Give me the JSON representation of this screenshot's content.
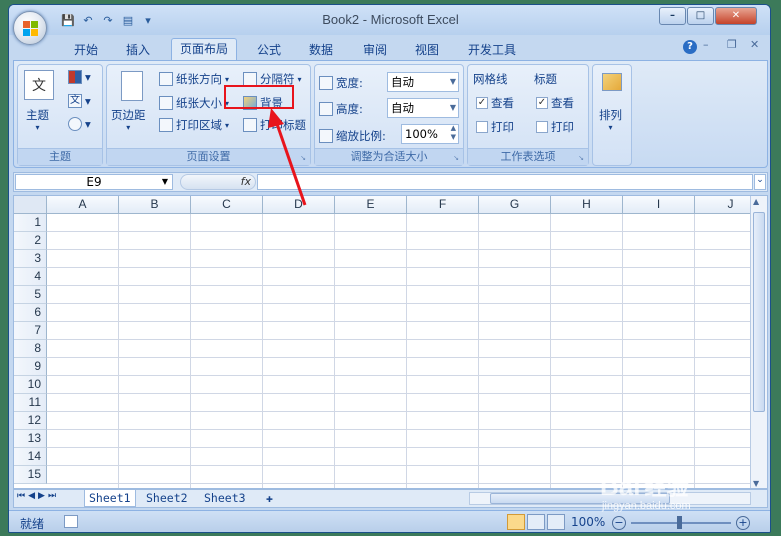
{
  "window": {
    "title": "Book2 - Microsoft Excel"
  },
  "qat": {
    "save_icon": "💾",
    "undo_icon": "↶",
    "redo_icon": "↷",
    "print_preview_icon": "▤",
    "customize_icon": "▾"
  },
  "tabs": [
    "开始",
    "插入",
    "页面布局",
    "公式",
    "数据",
    "审阅",
    "视图",
    "开发工具"
  ],
  "active_tab": "页面布局",
  "ribbon": {
    "theme": {
      "big_label": "主题",
      "group": "主题"
    },
    "page_setup": {
      "margins": "页边距",
      "orientation": "纸张方向",
      "size": "纸张大小",
      "print_area": "打印区域",
      "breaks": "分隔符",
      "background": "背景",
      "print_titles": "打印标题",
      "group": "页面设置"
    },
    "scale": {
      "width_label": "宽度:",
      "width_value": "自动",
      "height_label": "高度:",
      "height_value": "自动",
      "scale_label": "缩放比例:",
      "scale_value": "100%",
      "group": "调整为合适大小"
    },
    "sheet_options": {
      "gridlines": "网格线",
      "headings": "标题",
      "view": "查看",
      "print": "打印",
      "group": "工作表选项"
    },
    "arrange": {
      "label": "排列"
    }
  },
  "formula_bar": {
    "name_box": "E9",
    "fx": "fx",
    "formula": ""
  },
  "columns": [
    "A",
    "B",
    "C",
    "D",
    "E",
    "F",
    "G",
    "H",
    "I",
    "J"
  ],
  "rows": [
    "1",
    "2",
    "3",
    "4",
    "5",
    "6",
    "7",
    "8",
    "9",
    "10",
    "11",
    "12",
    "13",
    "14",
    "15"
  ],
  "sheets": [
    "Sheet1",
    "Sheet2",
    "Sheet3"
  ],
  "status": {
    "ready": "就绪",
    "zoom": "100%"
  },
  "watermark": {
    "brand": "Bai",
    "brand2": "经验",
    "url": "jingyan.baidu.com"
  },
  "colors": {
    "annotation": "#e8141c",
    "ribbon": "#dfeaf7"
  }
}
